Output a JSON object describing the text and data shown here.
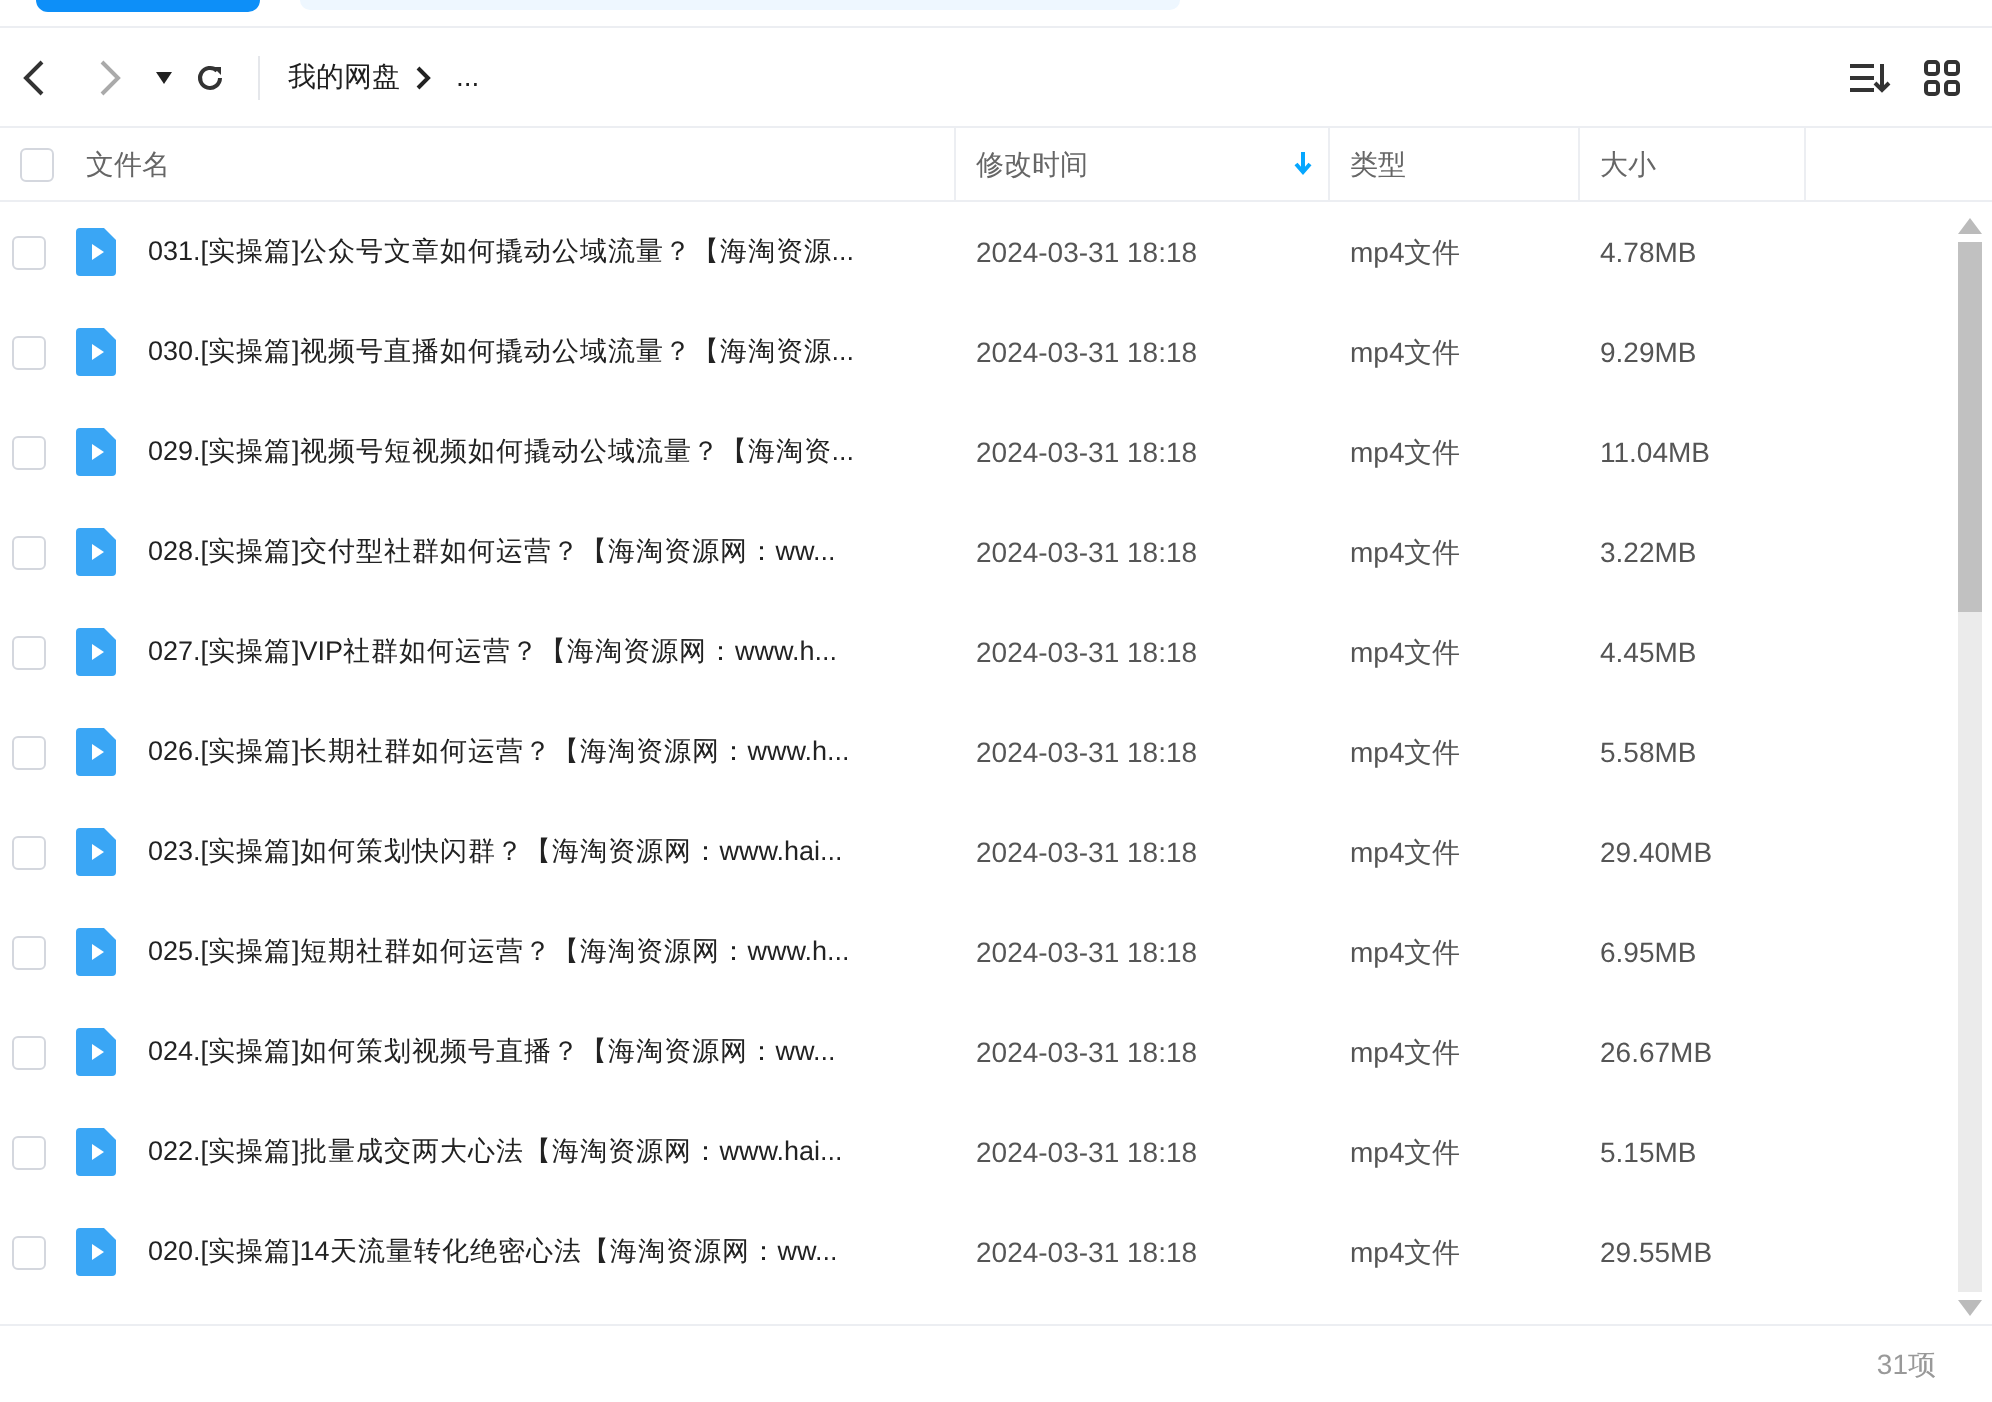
{
  "breadcrumb": {
    "root": "我的网盘",
    "rest": "..."
  },
  "select_all": {
    "checked": false
  },
  "columns": [
    {
      "label": "文件名",
      "sorted": false
    },
    {
      "label": "修改时间",
      "sorted": true
    },
    {
      "label": "类型",
      "sorted": false
    },
    {
      "label": "大小",
      "sorted": false
    }
  ],
  "rows": [
    {
      "name": "031.[实操篇]公众号文章如何撬动公域流量？【海淘资源...",
      "time": "2024-03-31 18:18",
      "type": "mp4文件",
      "size": "4.78MB",
      "checked": false
    },
    {
      "name": "030.[实操篇]视频号直播如何撬动公域流量？【海淘资源...",
      "time": "2024-03-31 18:18",
      "type": "mp4文件",
      "size": "9.29MB",
      "checked": false
    },
    {
      "name": "029.[实操篇]视频号短视频如何撬动公域流量？【海淘资...",
      "time": "2024-03-31 18:18",
      "type": "mp4文件",
      "size": "11.04MB",
      "checked": false
    },
    {
      "name": "028.[实操篇]交付型社群如何运营？【海淘资源网：ww...",
      "time": "2024-03-31 18:18",
      "type": "mp4文件",
      "size": "3.22MB",
      "checked": false
    },
    {
      "name": "027.[实操篇]VIP社群如何运营？【海淘资源网：www.h...",
      "time": "2024-03-31 18:18",
      "type": "mp4文件",
      "size": "4.45MB",
      "checked": false
    },
    {
      "name": "026.[实操篇]长期社群如何运营？【海淘资源网：www.h...",
      "time": "2024-03-31 18:18",
      "type": "mp4文件",
      "size": "5.58MB",
      "checked": false
    },
    {
      "name": "023.[实操篇]如何策划快闪群？【海淘资源网：www.hai...",
      "time": "2024-03-31 18:18",
      "type": "mp4文件",
      "size": "29.40MB",
      "checked": false
    },
    {
      "name": "025.[实操篇]短期社群如何运营？【海淘资源网：www.h...",
      "time": "2024-03-31 18:18",
      "type": "mp4文件",
      "size": "6.95MB",
      "checked": false
    },
    {
      "name": "024.[实操篇]如何策划视频号直播？【海淘资源网：ww...",
      "time": "2024-03-31 18:18",
      "type": "mp4文件",
      "size": "26.67MB",
      "checked": false
    },
    {
      "name": "022.[实操篇]批量成交两大心法【海淘资源网：www.hai...",
      "time": "2024-03-31 18:18",
      "type": "mp4文件",
      "size": "5.15MB",
      "checked": false
    },
    {
      "name": "020.[实操篇]14天流量转化绝密心法【海淘资源网：ww...",
      "time": "2024-03-31 18:18",
      "type": "mp4文件",
      "size": "29.55MB",
      "checked": false
    }
  ],
  "status_bar": {
    "count": "31项"
  }
}
